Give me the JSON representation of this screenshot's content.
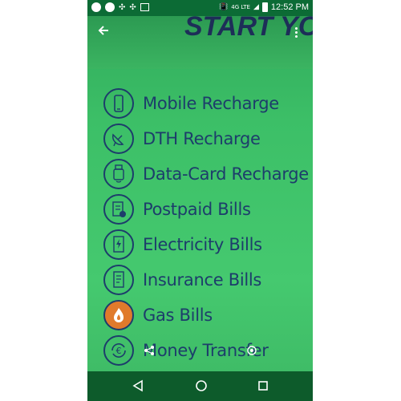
{
  "status_bar": {
    "network": "4G LTE",
    "time": "12:52 PM"
  },
  "header": {
    "title": "START YO"
  },
  "menu": {
    "items": [
      {
        "label": "Mobile Recharge",
        "icon": "mobile-phone-icon"
      },
      {
        "label": "DTH Recharge",
        "icon": "satellite-dish-icon"
      },
      {
        "label": "Data-Card Recharge",
        "icon": "usb-datacard-icon"
      },
      {
        "label": "Postpaid Bills",
        "icon": "postpaid-bill-icon"
      },
      {
        "label": "Electricity Bills",
        "icon": "electricity-bill-icon"
      },
      {
        "label": "Insurance Bills",
        "icon": "insurance-document-icon"
      },
      {
        "label": "Gas Bills",
        "icon": "gas-flame-icon"
      },
      {
        "label": "Money Transfer",
        "icon": "euro-transfer-icon"
      }
    ]
  },
  "colors": {
    "accent": "#1d3d6b",
    "background_green": "#45c96f",
    "status_bar": "#0c6b35",
    "nav_bar": "#0d5b2b",
    "gas_icon": "#e07a2c"
  }
}
